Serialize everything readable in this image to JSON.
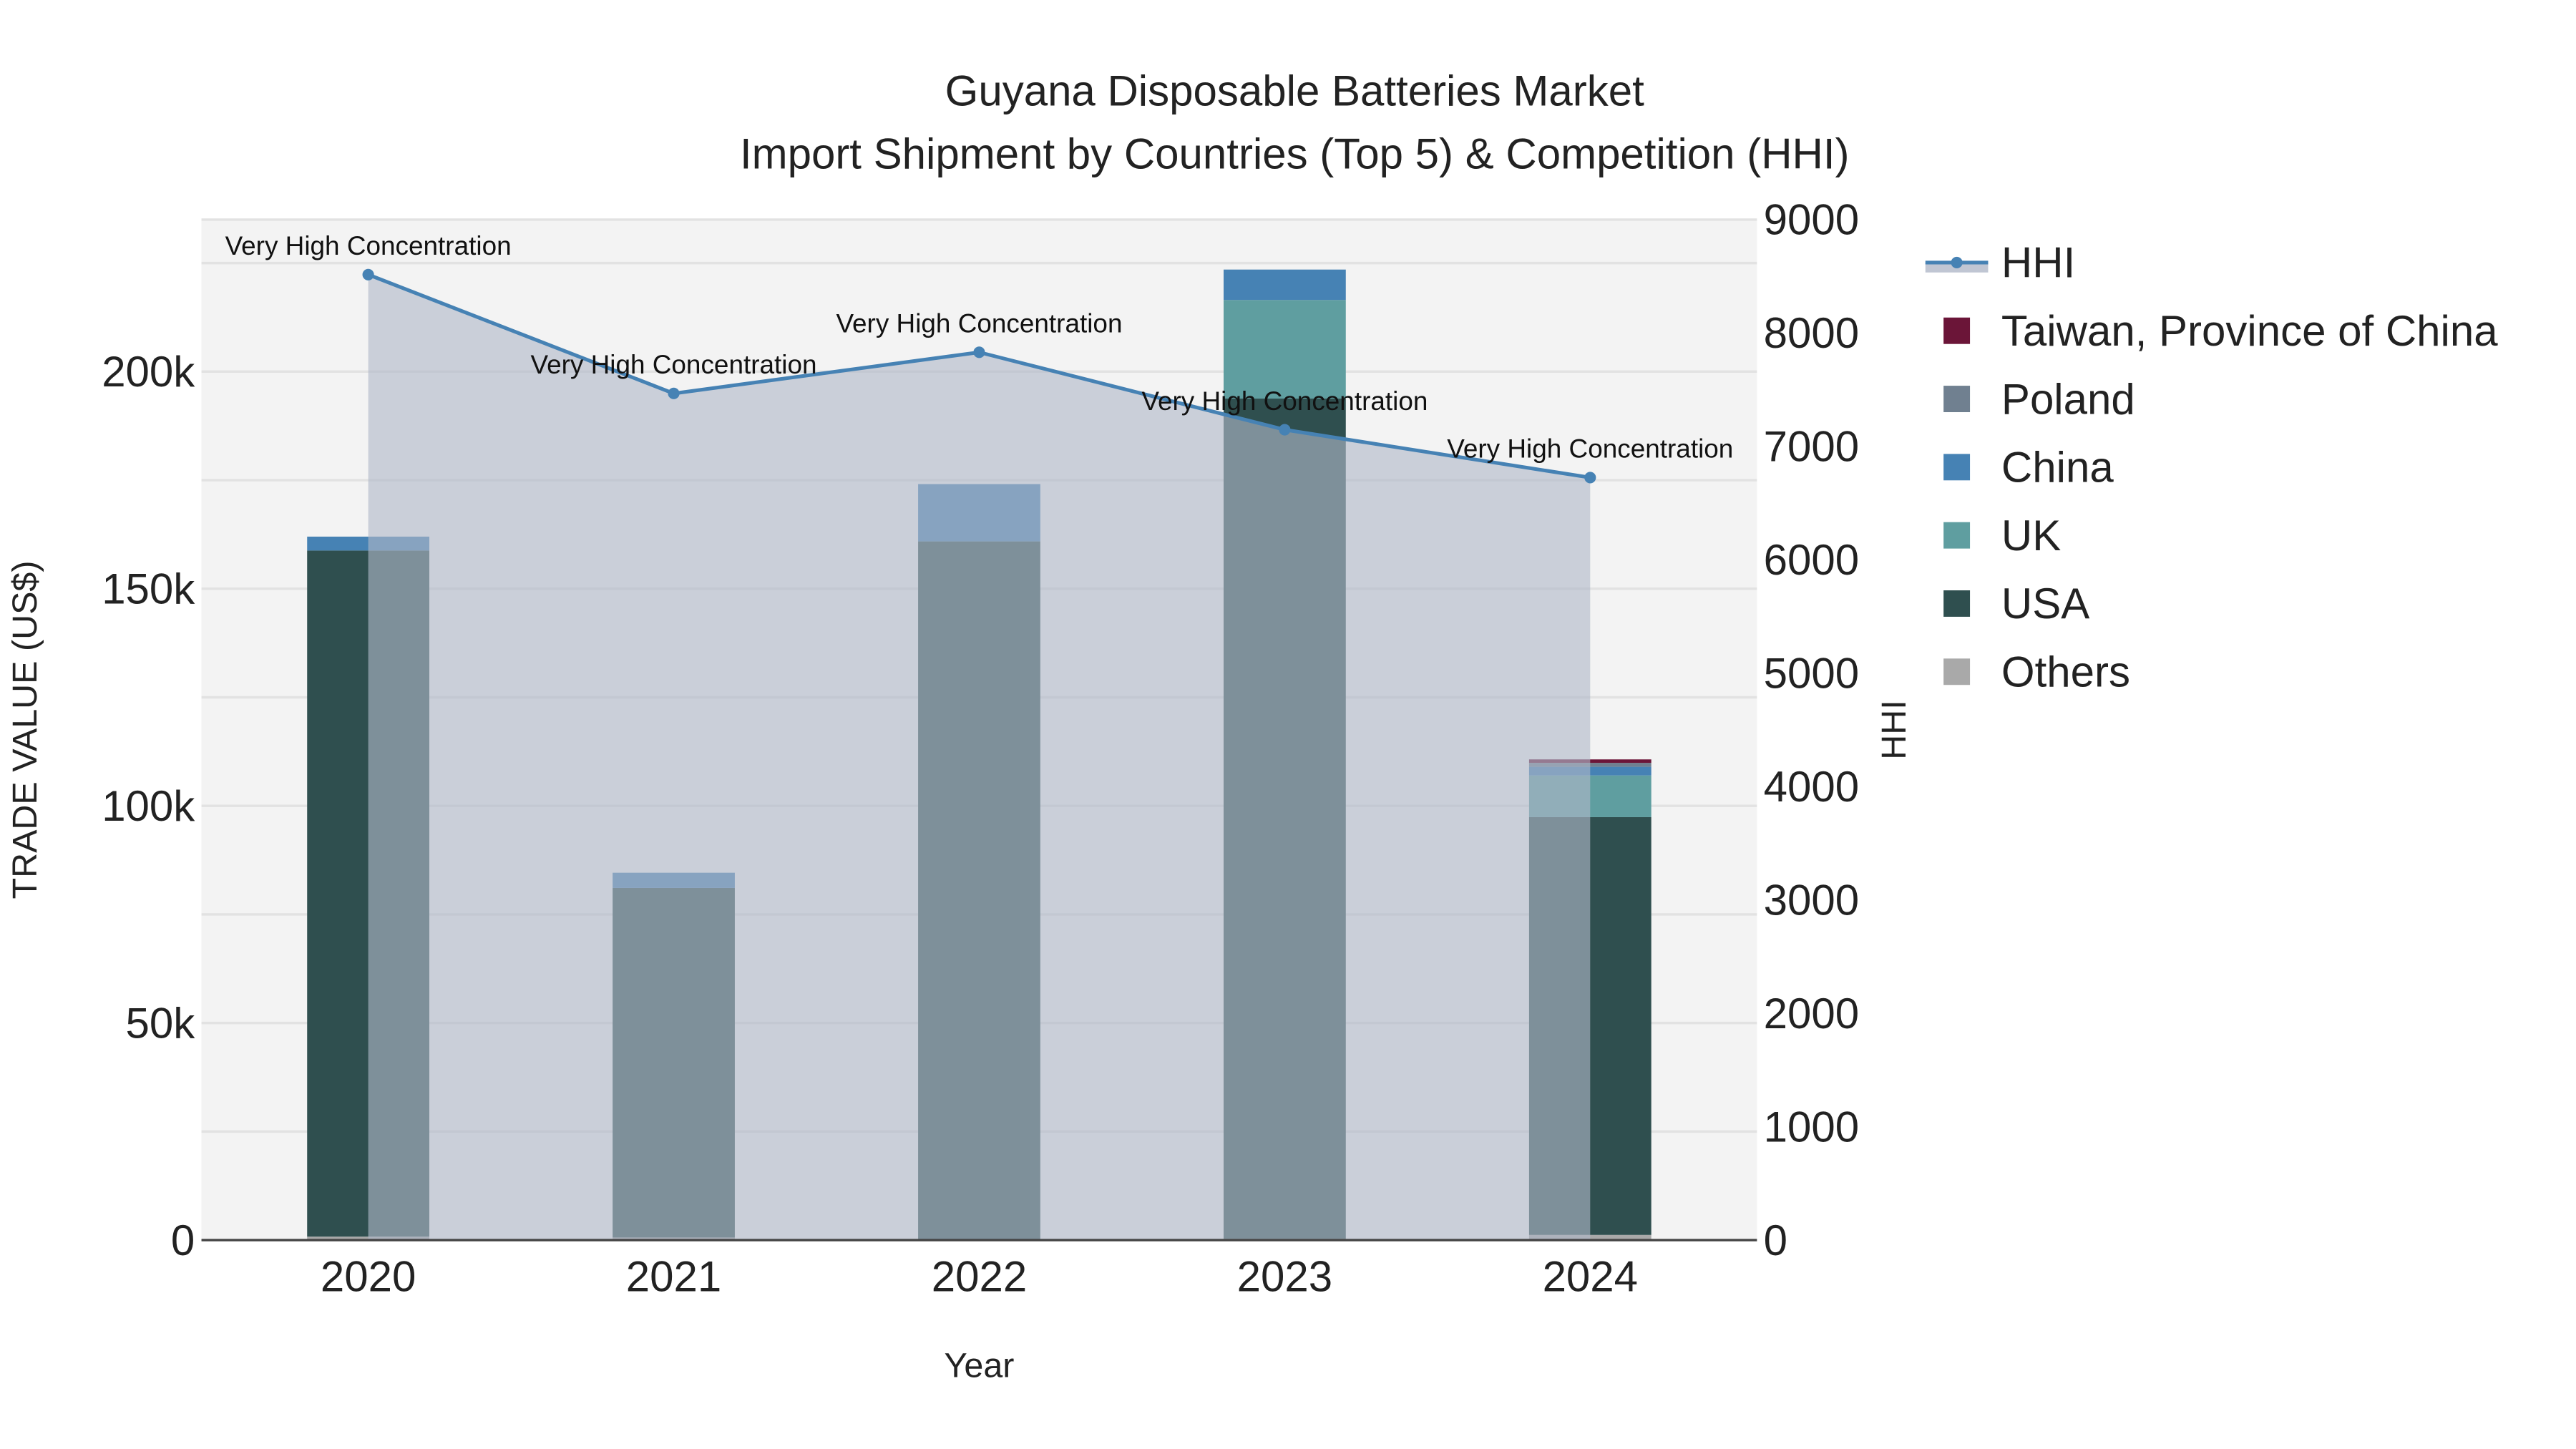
{
  "chart_data": {
    "type": "bar",
    "title": "Guyana Disposable Batteries Market",
    "subtitle": "Import Shipment by Countries (Top 5) & Competition (HHI)",
    "xlabel": "Year",
    "ylabel": "TRADE VALUE (US$)",
    "y2label": "HHI",
    "categories": [
      "2020",
      "2021",
      "2022",
      "2023",
      "2024"
    ],
    "ylim": [
      0,
      235000
    ],
    "y2lim": [
      0,
      9000
    ],
    "yticks": [
      0,
      50000,
      100000,
      150000,
      200000
    ],
    "ytick_labels": [
      "0",
      "50k",
      "100k",
      "150k",
      "200k"
    ],
    "y2ticks": [
      0,
      1000,
      2000,
      3000,
      4000,
      5000,
      6000,
      7000,
      8000,
      9000
    ],
    "y2tick_labels": [
      "0",
      "1000",
      "2000",
      "3000",
      "4000",
      "5000",
      "6000",
      "7000",
      "8000",
      "9000"
    ],
    "series": [
      {
        "name": "Others",
        "color": "#a9a9a9",
        "values": [
          800,
          600,
          100,
          300,
          1200
        ]
      },
      {
        "name": "USA",
        "color": "#2f4f4f",
        "values": [
          158000,
          80500,
          160800,
          193500,
          96200
        ]
      },
      {
        "name": "UK",
        "color": "#5f9ea0",
        "values": [
          0,
          0,
          0,
          22700,
          9600
        ]
      },
      {
        "name": "China",
        "color": "#4682b4",
        "values": [
          3200,
          3500,
          13200,
          7000,
          2000
        ]
      },
      {
        "name": "Poland",
        "color": "#708090",
        "values": [
          0,
          0,
          0,
          0,
          900
        ]
      },
      {
        "name": "Taiwan, Province of China",
        "color": "#6b1538",
        "values": [
          0,
          0,
          0,
          0,
          800
        ]
      }
    ],
    "hhi": {
      "name": "HHI",
      "color": "#4682b4",
      "values": [
        8515,
        7467,
        7830,
        7147,
        6725
      ],
      "annotations": [
        "Very High Concentration",
        "Very High Concentration",
        "Very High Concentration",
        "Very High Concentration",
        "Very High Concentration"
      ]
    },
    "legend": {
      "placement": "right",
      "items": [
        "HHI",
        "Taiwan, Province of China",
        "Poland",
        "China",
        "UK",
        "USA",
        "Others"
      ]
    },
    "grid": true
  }
}
